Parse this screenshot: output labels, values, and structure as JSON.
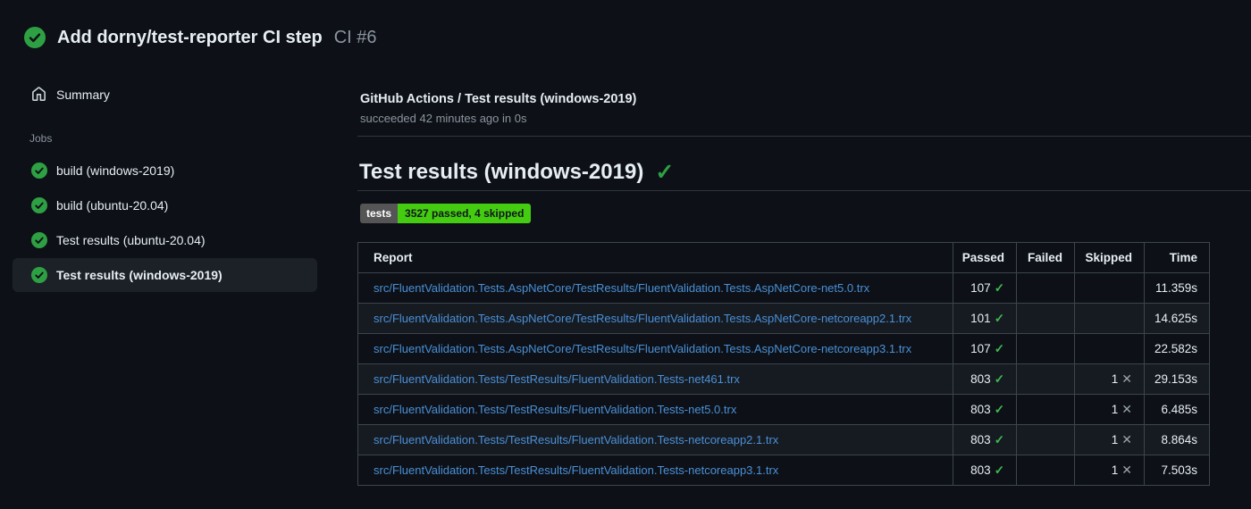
{
  "colors": {
    "background": "#0d1117",
    "row_alt": "#161b22",
    "table_border": "#3d444d",
    "success_green": "#2ea043",
    "check_green": "#3fb950",
    "badge_green": "#44cc11",
    "badge_label_bg": "#555555",
    "link_blue": "#4a8fd6",
    "muted_text": "#8b949e",
    "selected_item_bg": "#1c2128"
  },
  "header": {
    "title": "Add dorny/test-reporter CI step",
    "run_number": "CI #6"
  },
  "sidebar": {
    "summary_label": "Summary",
    "jobs_label": "Jobs",
    "jobs": [
      {
        "label": "build (windows-2019)",
        "status": "success",
        "selected": false
      },
      {
        "label": "build (ubuntu-20.04)",
        "status": "success",
        "selected": false
      },
      {
        "label": "Test results (ubuntu-20.04)",
        "status": "success",
        "selected": false
      },
      {
        "label": "Test results (windows-2019)",
        "status": "success",
        "selected": true
      }
    ]
  },
  "main": {
    "check_name": "GitHub Actions / Test results (windows-2019)",
    "check_status": "succeeded 42 minutes ago in 0s",
    "section_title": "Test results (windows-2019)",
    "badge": {
      "label": "tests",
      "value": "3527 passed, 4 skipped"
    },
    "table": {
      "headers": [
        "Report",
        "Passed",
        "Failed",
        "Skipped",
        "Time"
      ],
      "rows": [
        {
          "report": "src/FluentValidation.Tests.AspNetCore/TestResults/FluentValidation.Tests.AspNetCore-net5.0.trx",
          "passed": "107",
          "failed": "",
          "skipped": "",
          "time": "11.359s"
        },
        {
          "report": "src/FluentValidation.Tests.AspNetCore/TestResults/FluentValidation.Tests.AspNetCore-netcoreapp2.1.trx",
          "passed": "101",
          "failed": "",
          "skipped": "",
          "time": "14.625s"
        },
        {
          "report": "src/FluentValidation.Tests.AspNetCore/TestResults/FluentValidation.Tests.AspNetCore-netcoreapp3.1.trx",
          "passed": "107",
          "failed": "",
          "skipped": "",
          "time": "22.582s"
        },
        {
          "report": "src/FluentValidation.Tests/TestResults/FluentValidation.Tests-net461.trx",
          "passed": "803",
          "failed": "",
          "skipped": "1",
          "time": "29.153s"
        },
        {
          "report": "src/FluentValidation.Tests/TestResults/FluentValidation.Tests-net5.0.trx",
          "passed": "803",
          "failed": "",
          "skipped": "1",
          "time": "6.485s"
        },
        {
          "report": "src/FluentValidation.Tests/TestResults/FluentValidation.Tests-netcoreapp2.1.trx",
          "passed": "803",
          "failed": "",
          "skipped": "1",
          "time": "8.864s"
        },
        {
          "report": "src/FluentValidation.Tests/TestResults/FluentValidation.Tests-netcoreapp3.1.trx",
          "passed": "803",
          "failed": "",
          "skipped": "1",
          "time": "7.503s"
        }
      ]
    }
  },
  "icons": {
    "status": "check-circle-icon",
    "summary": "home-icon",
    "passed": "check-icon",
    "skipped": "x-icon"
  }
}
